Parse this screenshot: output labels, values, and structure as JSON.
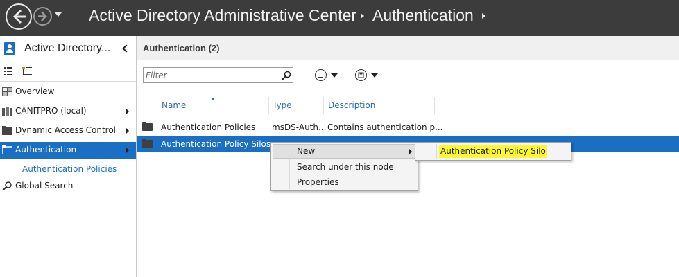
{
  "titlebar": {
    "crumbs": [
      "Active Directory Administrative Center",
      "Authentication"
    ]
  },
  "leftpane": {
    "title": "Active Directory...",
    "items": [
      {
        "label": "Overview",
        "icon": "overview-icon",
        "has_arrow": false
      },
      {
        "label": "CANITPRO (local)",
        "icon": "domain-icon",
        "has_arrow": true
      },
      {
        "label": "Dynamic Access Control",
        "icon": "folder-icon",
        "has_arrow": true
      },
      {
        "label": "Authentication",
        "icon": "folder-icon",
        "has_arrow": true,
        "selected": true
      },
      {
        "label": "Global Search",
        "icon": "search-icon",
        "has_arrow": false
      }
    ],
    "subitem": "Authentication Policies"
  },
  "main": {
    "title": "Authentication  (2)",
    "filter_placeholder": "Filter",
    "columns": [
      "Name",
      "Type",
      "Description"
    ],
    "rows": [
      {
        "name": "Authentication Policies",
        "type": "msDS-Auth...",
        "description": "Contains authentication p..."
      },
      {
        "name": "Authentication Policy Silos",
        "type": "",
        "description": "",
        "selected": true
      }
    ]
  },
  "context_menu": {
    "items": [
      "New",
      "Search under this node",
      "Properties"
    ]
  },
  "submenu": {
    "item": "Authentication Policy Silo",
    "highlight_color": "#fff82e"
  },
  "colors": {
    "accent": "#1b6fc2",
    "titlebar": "#3c3c3c"
  }
}
